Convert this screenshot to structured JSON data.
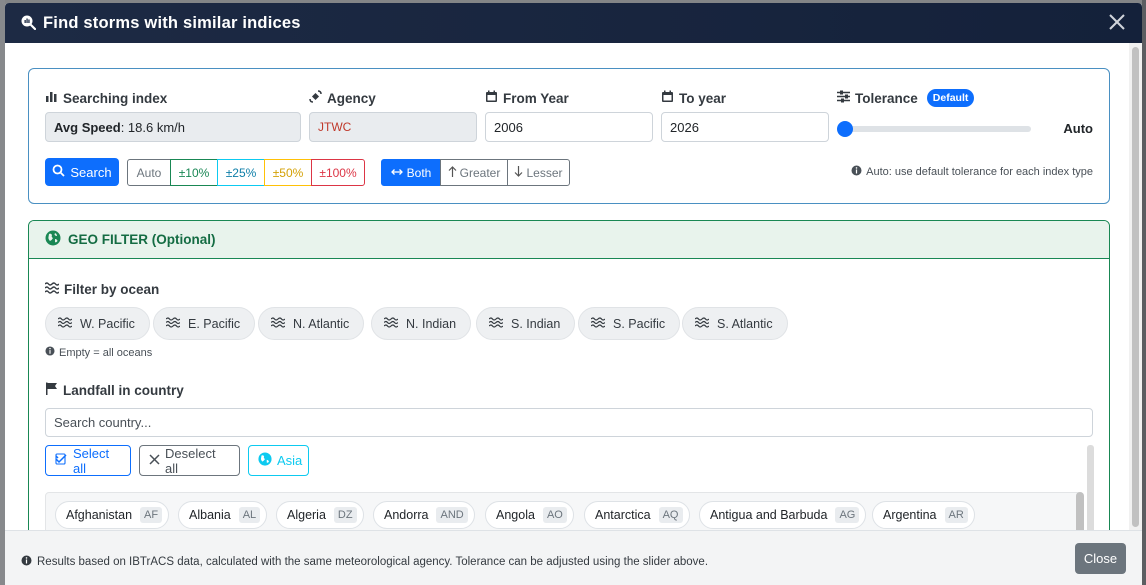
{
  "modal": {
    "title": "Find storms with similar indices"
  },
  "search": {
    "index_label": "Searching index",
    "index_name": "Avg Speed",
    "index_value": ": 18.6 km/h",
    "agency_label": "Agency",
    "agency_value": "JTWC",
    "from_label": "From Year",
    "from_value": "2006",
    "to_label": "To year",
    "to_value": "2026",
    "tolerance_label": "Tolerance",
    "tolerance_badge": "Default",
    "tolerance_value": "Auto",
    "search_button": "Search",
    "tolerance_options": [
      "Auto",
      "±10%",
      "±25%",
      "±50%",
      "±100%"
    ],
    "direction_options": [
      "Both",
      "Greater",
      "Lesser"
    ],
    "auto_note": "Auto: use default tolerance for each index type"
  },
  "geo": {
    "header": "GEO FILTER (Optional)",
    "ocean_label": "Filter by ocean",
    "oceans": [
      "W. Pacific",
      "E. Pacific",
      "N. Atlantic",
      "N. Indian",
      "S. Indian",
      "S. Pacific",
      "S. Atlantic"
    ],
    "ocean_note": "Empty = all oceans",
    "landfall_label": "Landfall in country",
    "country_placeholder": "Search country...",
    "select_all": "Select all",
    "deselect_all": "Deselect all",
    "region": "Asia",
    "countries": [
      {
        "name": "Afghanistan",
        "code": "AF"
      },
      {
        "name": "Albania",
        "code": "AL"
      },
      {
        "name": "Algeria",
        "code": "DZ"
      },
      {
        "name": "Andorra",
        "code": "AND"
      },
      {
        "name": "Angola",
        "code": "AO"
      },
      {
        "name": "Antarctica",
        "code": "AQ"
      },
      {
        "name": "Antigua and Barbuda",
        "code": "AG"
      },
      {
        "name": "Argentina",
        "code": "AR"
      }
    ]
  },
  "footer": {
    "note": "Results based on IBTrACS data, calculated with the same meteorological agency. Tolerance can be adjusted using the slider above.",
    "close": "Close"
  },
  "colors": {
    "primary": "#0d6efd",
    "success": "#198754",
    "header_bg": "#1d2a44"
  }
}
